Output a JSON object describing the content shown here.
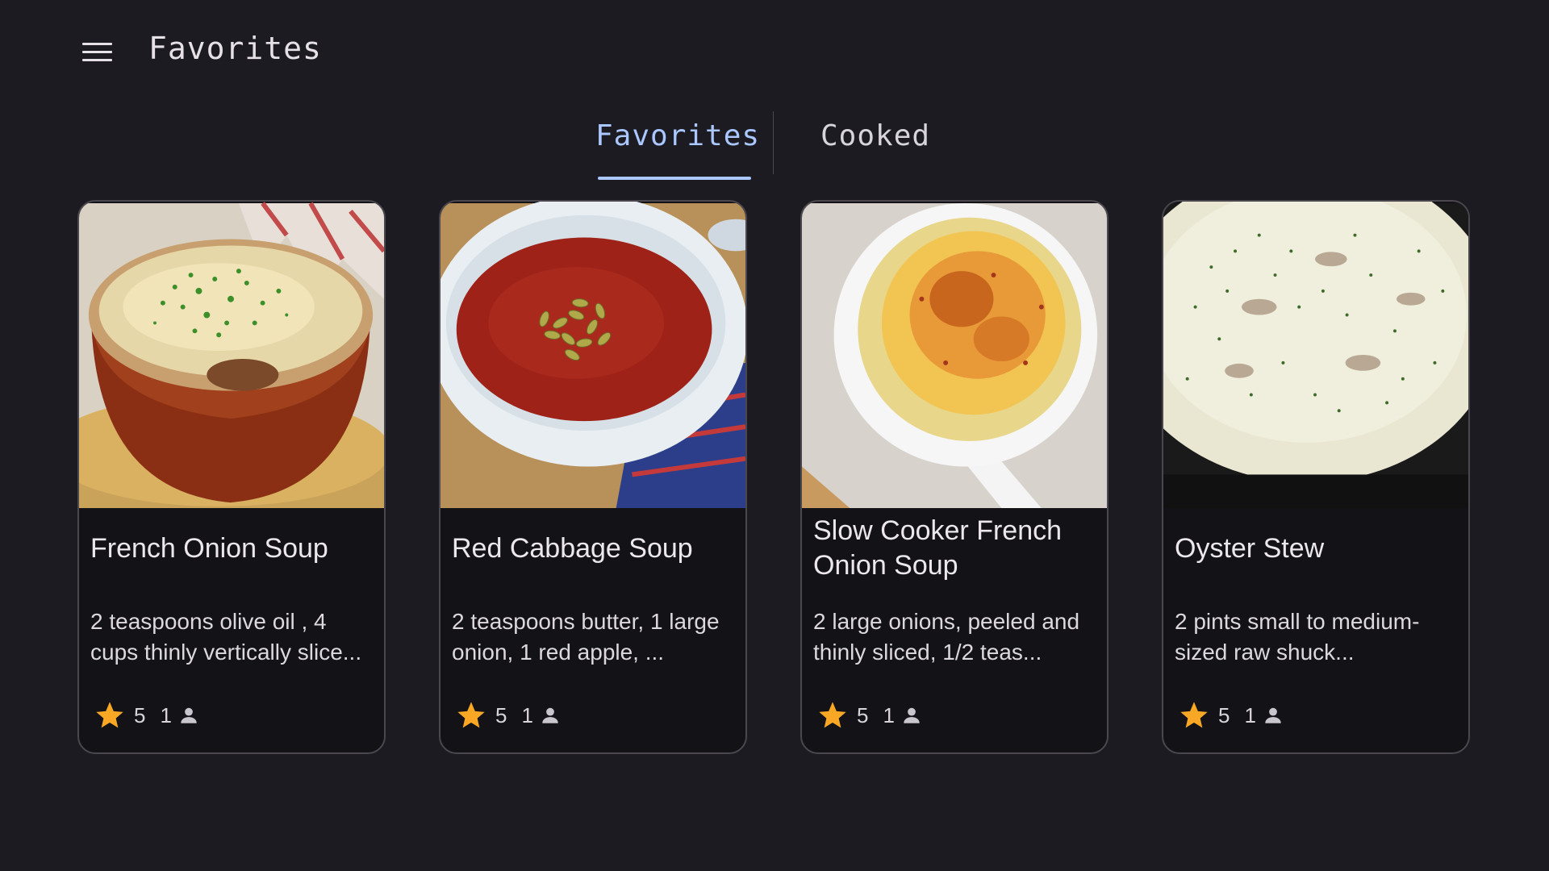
{
  "app": {
    "title": "Favorites"
  },
  "tabs": [
    {
      "label": "Favorites",
      "selected": true
    },
    {
      "label": "Cooked",
      "selected": false
    }
  ],
  "cards": [
    {
      "title": "French Onion Soup",
      "description": "2 teaspoons olive oil , 4 cups thinly vertically slice...",
      "rating": "5",
      "count": "1",
      "image": "french-onion-soup-photo"
    },
    {
      "title": "Red Cabbage Soup",
      "description": "2 teaspoons butter, 1 large onion, 1 red apple, ...",
      "rating": "5",
      "count": "1",
      "image": "red-cabbage-soup-photo"
    },
    {
      "title": "Slow Cooker French Onion Soup",
      "description": "2 large onions, peeled and thinly sliced, 1/2 teas...",
      "rating": "5",
      "count": "1",
      "image": "slow-cooker-french-onion-soup-photo"
    },
    {
      "title": "Oyster Stew",
      "description": "2 pints small to medium-sized raw shuck...",
      "rating": "5",
      "count": "1",
      "image": "oyster-stew-photo"
    }
  ],
  "colors": {
    "background": "#1c1b21",
    "accent": "#aac7ff",
    "star": "#f9a825",
    "card_border": "#4a474f"
  },
  "icons": {
    "menu": "hamburger-menu-icon",
    "rating": "star-icon",
    "user": "person-icon"
  }
}
